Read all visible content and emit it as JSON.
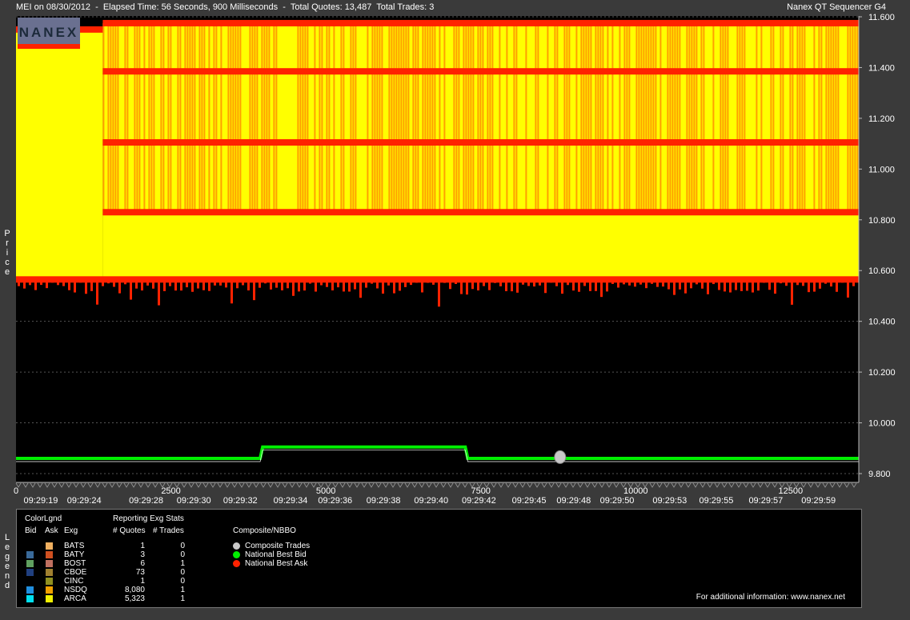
{
  "header": {
    "left": "MEI on 08/30/2012  -  Elapsed Time: 56 Seconds, 900 Milliseconds  -  Total Quotes: 13,487  Total Trades: 3",
    "right": "Nanex QT Sequencer G4",
    "logo": "NANEX"
  },
  "side_labels": {
    "price": "Price",
    "legend": "Legend"
  },
  "chart_data": {
    "type": "area",
    "title": "",
    "ylabel": "Price",
    "ylim": [
      9.8,
      11.6
    ],
    "y_ticks": [
      "11.600",
      "11.400",
      "11.200",
      "11.000",
      "10.800",
      "10.600",
      "10.400",
      "10.200",
      "10.000",
      "9.800"
    ],
    "xlim": [
      0,
      13600
    ],
    "x_ticks": [
      0,
      2500,
      5000,
      7500,
      10000,
      12500
    ],
    "x_tick_labels": [
      "0",
      "2500",
      "5000",
      "7500",
      "10000",
      "12500"
    ],
    "time_labels": [
      {
        "x": 400,
        "label": "09:29:19"
      },
      {
        "x": 1100,
        "label": "09:29:24"
      },
      {
        "x": 2100,
        "label": "09:29:28"
      },
      {
        "x": 2870,
        "label": "09:29:30"
      },
      {
        "x": 3620,
        "label": "09:29:32"
      },
      {
        "x": 4430,
        "label": "09:29:34"
      },
      {
        "x": 5150,
        "label": "09:29:36"
      },
      {
        "x": 5930,
        "label": "09:29:38"
      },
      {
        "x": 6700,
        "label": "09:29:40"
      },
      {
        "x": 7470,
        "label": "09:29:42"
      },
      {
        "x": 8280,
        "label": "09:29:45"
      },
      {
        "x": 9000,
        "label": "09:29:48"
      },
      {
        "x": 9700,
        "label": "09:29:50"
      },
      {
        "x": 10550,
        "label": "09:29:53"
      },
      {
        "x": 11300,
        "label": "09:29:55"
      },
      {
        "x": 12100,
        "label": "09:29:57"
      },
      {
        "x": 12950,
        "label": "09:29:59"
      }
    ],
    "series": [
      {
        "name": "National Best Bid",
        "color": "#00ee00",
        "points": [
          [
            0,
            9.86
          ],
          [
            3940,
            9.86
          ],
          [
            3980,
            9.905
          ],
          [
            7250,
            9.905
          ],
          [
            7290,
            9.86
          ],
          [
            13600,
            9.86
          ]
        ]
      },
      {
        "name": "National Best Ask",
        "color": "#ff2200",
        "levels": [
          {
            "x0": 0,
            "x1": 1400,
            "y": 11.55
          },
          {
            "x0": 1400,
            "x1": 13600,
            "y": 11.575
          },
          {
            "x0": 1400,
            "x1": 13600,
            "y": 11.385
          },
          {
            "x0": 1400,
            "x1": 13600,
            "y": 11.105
          },
          {
            "x0": 1400,
            "x1": 13600,
            "y": 10.83
          },
          {
            "x0": 0,
            "x1": 13600,
            "y": 10.565
          }
        ]
      },
      {
        "name": "Composite Trades",
        "color": "#c8c8c8",
        "points": [
          [
            8780,
            9.865
          ]
        ]
      }
    ],
    "quote_band": {
      "x0": 0,
      "x1": 13600,
      "y_low": 10.57,
      "y_high": 11.575,
      "colors": [
        "#ffff00",
        "#ffa000"
      ]
    }
  },
  "legend": {
    "header_colorlgnd": "ColorLgnd",
    "header_bid": "Bid",
    "header_ask": "Ask",
    "header_exg": "Exg",
    "header_stats": "Reporting Exg Stats",
    "header_quotes": "# Quotes",
    "header_trades": "# Trades",
    "header_composite": "Composite/NBBO",
    "rows": [
      {
        "exg": "BATS",
        "quotes": "1",
        "trades": "0",
        "bid": "",
        "ask": "#f0b060"
      },
      {
        "exg": "BATY",
        "quotes": "3",
        "trades": "0",
        "bid": "#3a6a9a",
        "ask": "#d05020"
      },
      {
        "exg": "BOST",
        "quotes": "6",
        "trades": "1",
        "bid": "#60a060",
        "ask": "#c07060"
      },
      {
        "exg": "CBOE",
        "quotes": "73",
        "trades": "0",
        "bid": "#204080",
        "ask": "#a08030"
      },
      {
        "exg": "CINC",
        "quotes": "1",
        "trades": "0",
        "bid": "",
        "ask": "#909020"
      },
      {
        "exg": "NSDQ",
        "quotes": "8,080",
        "trades": "1",
        "bid": "#2090e0",
        "ask": "#f0a000"
      },
      {
        "exg": "ARCA",
        "quotes": "5,323",
        "trades": "1",
        "bid": "#00e0f0",
        "ask": "#f0f000"
      }
    ],
    "composite_items": [
      {
        "label": "Composite Trades",
        "color": "#c8c8c8"
      },
      {
        "label": "National Best Bid",
        "color": "#00ee00"
      },
      {
        "label": "National Best Ask",
        "color": "#ff2200"
      }
    ],
    "footer": "For additional information: www.nanex.net"
  }
}
